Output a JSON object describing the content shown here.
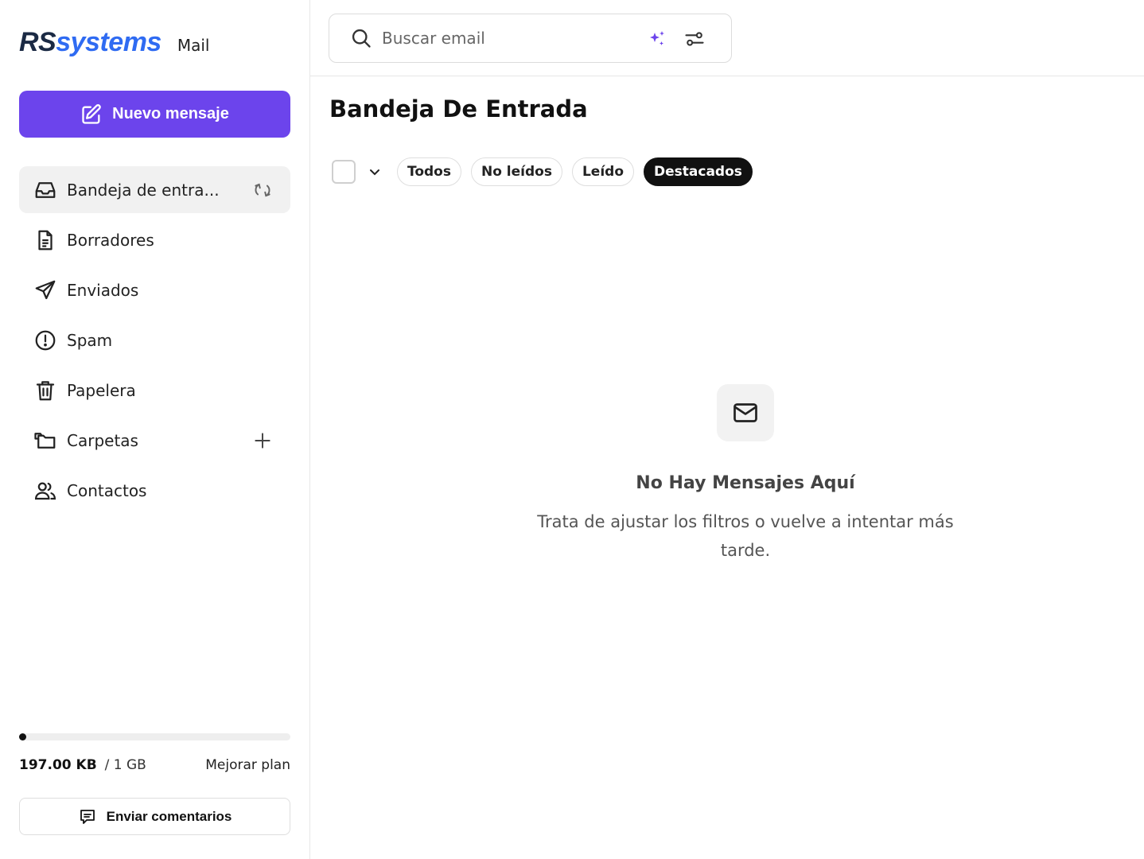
{
  "brand": {
    "logo_rs": "RS",
    "logo_systems": "systems",
    "product": "Mail"
  },
  "sidebar": {
    "new_message_label": "Nuevo mensaje",
    "items": [
      {
        "label": "Bandeja de entra...",
        "icon": "inbox-icon",
        "active": true,
        "trailing": "sync-icon"
      },
      {
        "label": "Borradores",
        "icon": "draft-file-icon"
      },
      {
        "label": "Enviados",
        "icon": "send-icon"
      },
      {
        "label": "Spam",
        "icon": "alert-circle-icon"
      },
      {
        "label": "Papelera",
        "icon": "trash-icon"
      },
      {
        "label": "Carpetas",
        "icon": "folders-icon",
        "trailing": "plus-icon"
      },
      {
        "label": "Contactos",
        "icon": "contacts-icon"
      }
    ],
    "storage": {
      "used": "197.00 KB",
      "total": "/ 1 GB",
      "used_fraction": 0.0002,
      "upgrade_label": "Mejorar plan"
    },
    "feedback_label": "Enviar comentarios"
  },
  "search": {
    "placeholder": "Buscar email"
  },
  "main": {
    "title": "Bandeja De Entrada",
    "filters": [
      "Todos",
      "No leídos",
      "Leído",
      "Destacados"
    ],
    "active_filter": "Destacados",
    "empty_title": "No Hay Mensajes Aquí",
    "empty_description": "Trata de ajustar los filtros o vuelve a intentar más tarde."
  },
  "colors": {
    "accent": "#6c44ec",
    "brand_dark": "#1b2a44",
    "brand_blue": "#2f6bf2",
    "active_chip": "#111111"
  }
}
